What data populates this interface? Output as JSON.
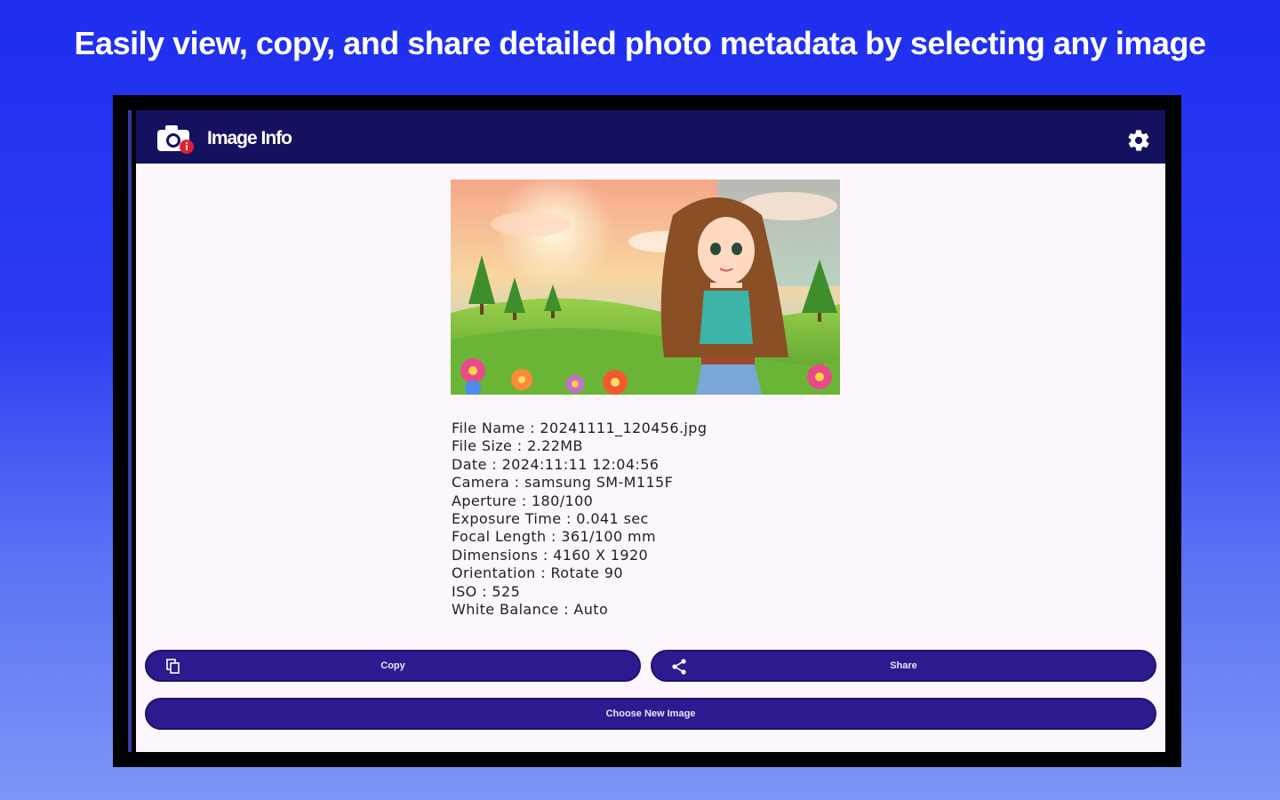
{
  "promo": {
    "caption": "Easily view, copy, and share detailed photo metadata by selecting any image"
  },
  "app": {
    "title": "Image Info",
    "logo_icon": "camera-info-icon",
    "settings_icon": "gear-icon"
  },
  "preview": {
    "image_description_icon": "photo-preview"
  },
  "metadata": [
    "File Name : 20241111_120456.jpg",
    "File Size : 2.22MB",
    "Date : 2024:11:11 12:04:56",
    "Camera : samsung SM-M115F",
    "Aperture : 180/100",
    "Exposure Time : 0.041 sec",
    "Focal Length : 361/100 mm",
    "Dimensions : 4160 X 1920",
    "Orientation : Rotate 90",
    "ISO : 525",
    "White Balance : Auto"
  ],
  "actions": {
    "copy_label": "Copy",
    "copy_icon": "copy-icon",
    "share_label": "Share",
    "share_icon": "share-icon",
    "choose_label": "Choose New Image"
  },
  "colors": {
    "app_bar": "#14125f",
    "button": "#2c1a8e",
    "screen_bg": "#fdf7fd",
    "promo_bg": "#1f2ef0"
  }
}
